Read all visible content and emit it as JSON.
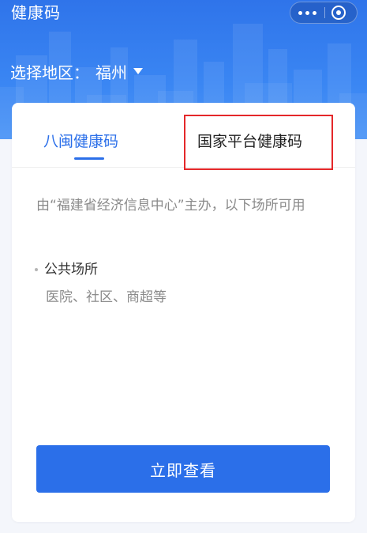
{
  "app": {
    "title": "健康码"
  },
  "capsule": {
    "more_icon": "more-dots-icon",
    "close_icon": "close-circle-icon"
  },
  "region": {
    "label": "选择地区：",
    "city": "福州",
    "caret_icon": "caret-down-icon"
  },
  "tabs": [
    {
      "label": "八闽健康码",
      "active": true
    },
    {
      "label": "国家平台健康码",
      "active": false,
      "highlighted": true
    }
  ],
  "content": {
    "description": "由“福建省经济信息中心”主办，以下场所可用",
    "places": [
      {
        "title": "公共场所",
        "examples": "医院、社区、商超等"
      }
    ]
  },
  "action": {
    "button_label": "立即查看"
  },
  "colors": {
    "brand_blue": "#2b6fe9",
    "header_blue": "#3a86f3",
    "highlight_red": "#e4282a",
    "muted_text": "#8a8a8a",
    "page_bg": "#f4f6fb"
  }
}
